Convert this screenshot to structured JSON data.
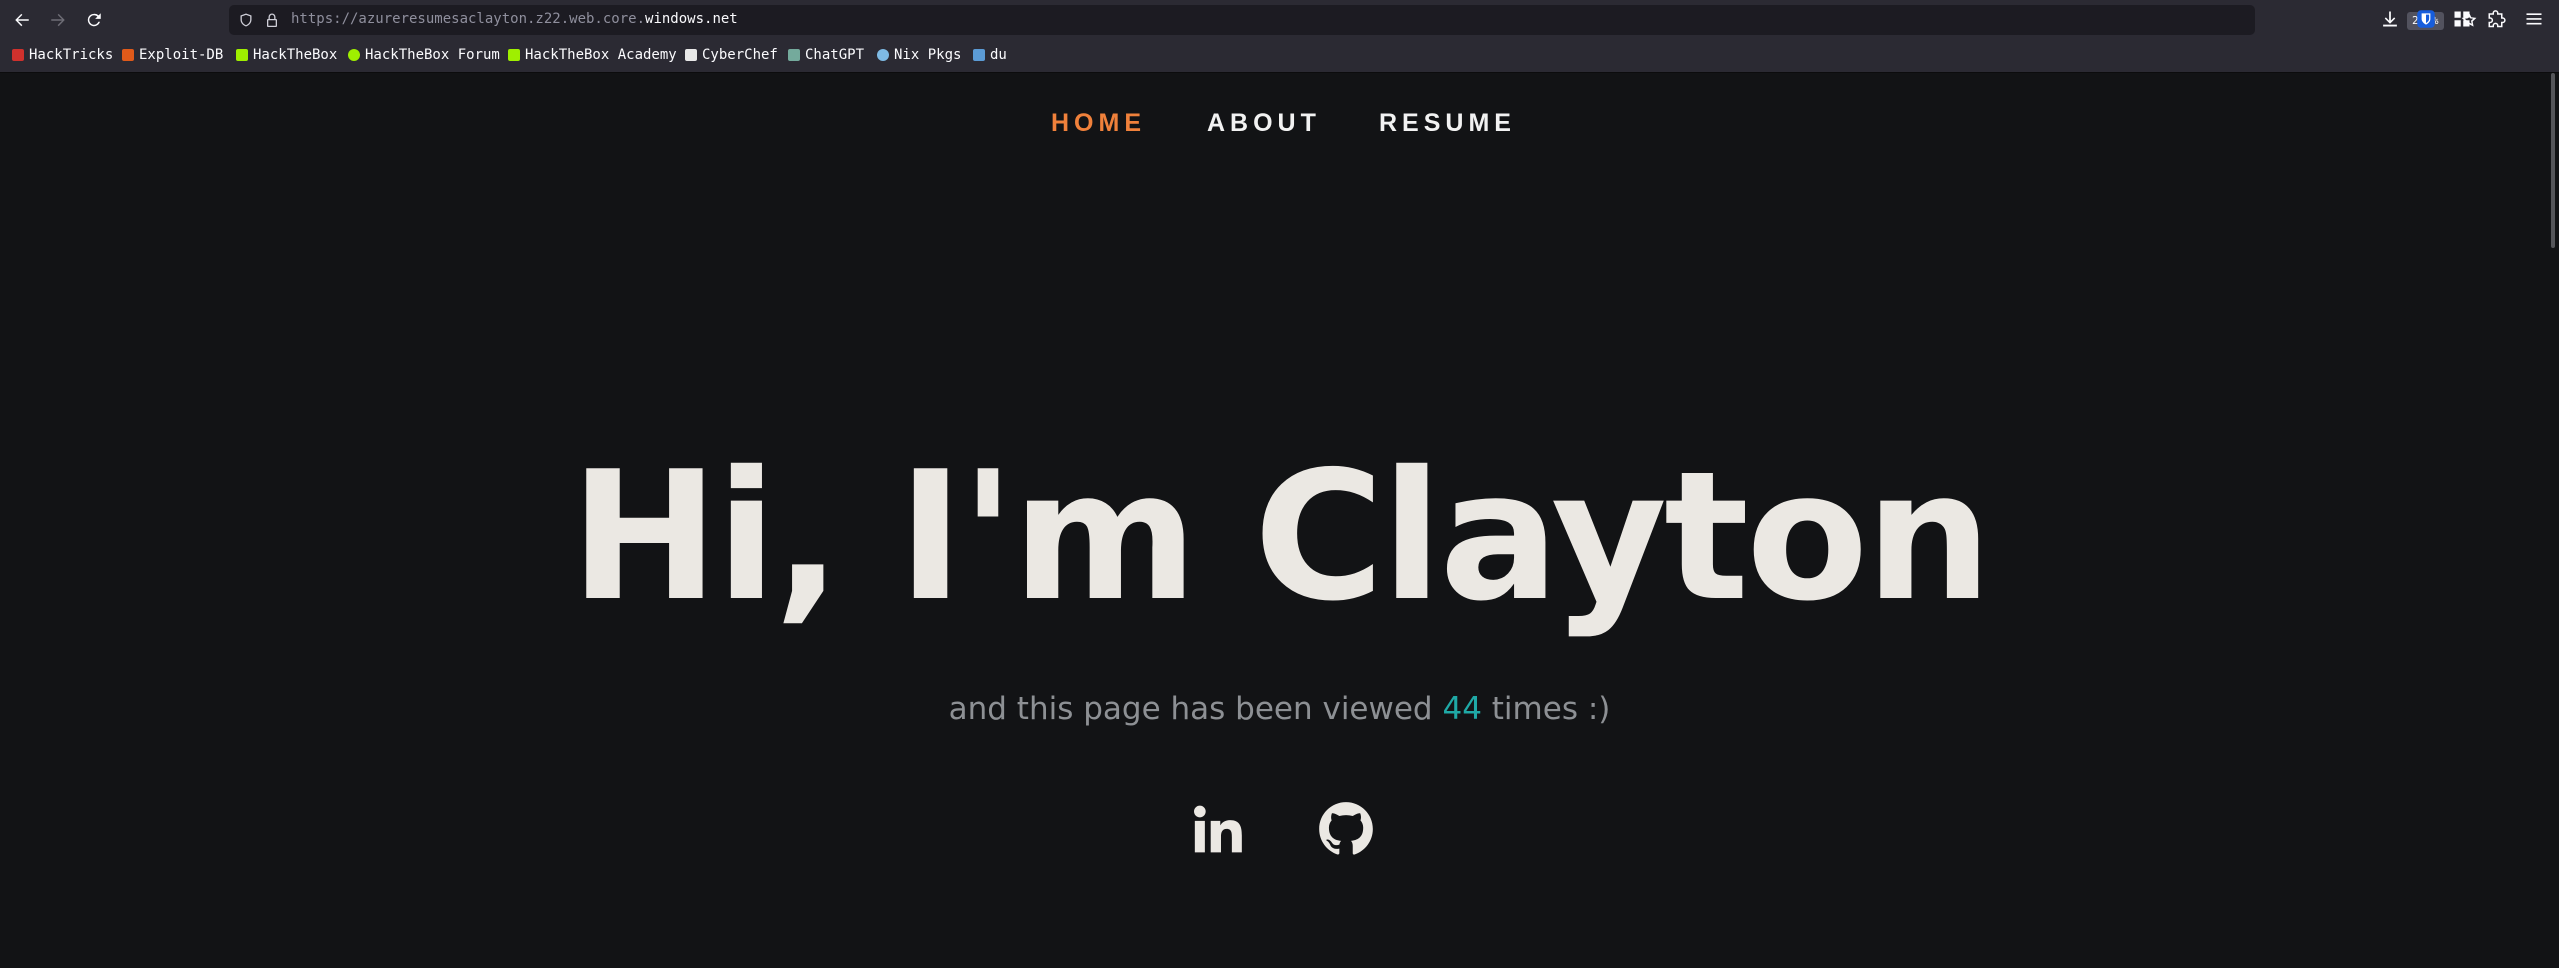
{
  "browser": {
    "url_prefix": "https://azureresumesaclayton.z22.web.core.",
    "url_domain": "windows.net",
    "zoom": "200%",
    "bookmarks": [
      {
        "label": "HackTricks",
        "color": "#d0312d"
      },
      {
        "label": "Exploit-DB",
        "color": "#e05a1a"
      },
      {
        "label": "HackTheBox",
        "color": "#9fef00"
      },
      {
        "label": "HackTheBox Forum",
        "color": "#9fef00"
      },
      {
        "label": "HackTheBox Academy",
        "color": "#9fef00"
      },
      {
        "label": "CyberChef",
        "color": "#e8e8e8"
      },
      {
        "label": "ChatGPT",
        "color": "#74aa9c"
      },
      {
        "label": "Nix Pkgs",
        "color": "#7ebae4"
      },
      {
        "label": "du",
        "color": "#5b9bd5"
      }
    ]
  },
  "site": {
    "nav": [
      {
        "label": "HOME",
        "active": true
      },
      {
        "label": "ABOUT",
        "active": false
      },
      {
        "label": "RESUME",
        "active": false
      }
    ],
    "hero_title": "Hi, I'm Clayton",
    "subtitle_before": "and this page has been viewed ",
    "view_count": "44",
    "subtitle_after": " times :)",
    "social": [
      {
        "icon": "linkedin-icon"
      },
      {
        "icon": "github-icon"
      }
    ]
  },
  "colors": {
    "accent": "#f0813b",
    "counter": "#1fa9a6",
    "background": "#121315"
  }
}
